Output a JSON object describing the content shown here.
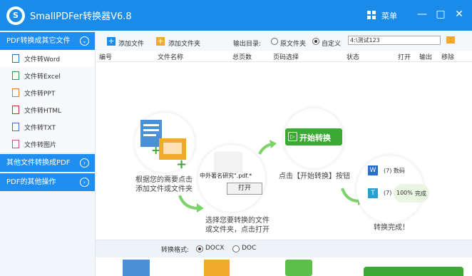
{
  "app": {
    "title": "SmallPDFer转换器V6.8",
    "menu_label": "菜单",
    "logo_letter": "S"
  },
  "window_controls": {
    "minimize": "—",
    "maximize": "□",
    "close": "✕"
  },
  "sidebar": {
    "cat1": "PDF转换成其它文件",
    "items": [
      "文件转Word",
      "文件转Excel",
      "文件转PPT",
      "文件转HTML",
      "文件转TXT",
      "文件转图片"
    ],
    "cat2": "其他文件转换成PDF",
    "cat3": "PDF的其他操作"
  },
  "toolbar": {
    "add_file": "添加文件",
    "add_folder": "添加文件夹",
    "output_label": "输出目录:",
    "opt_original": "原文件夹",
    "opt_custom": "自定义",
    "path_value": "4:\\测试123"
  },
  "table_headers": [
    "编号",
    "文件名称",
    "总页数",
    "页码选择",
    "状态",
    "打开",
    "输出",
    "移除"
  ],
  "illustration": {
    "step1_caption_line1": "根据您的需要点击",
    "step1_caption_line2": "添加文件或文件夹",
    "step2_caption_line1": "选择您要转换的文件",
    "step2_caption_line2": "或文件夹，点击打开",
    "step2_filename": "中外著名研究\".pdf.*",
    "step2_open": "打开",
    "step3_button": "开始转换",
    "step3_caption": "点击【开始转换】按钮",
    "step4_row1": "(7)  数码",
    "step4_row2": "(7)",
    "step4_progress": "100%",
    "step4_done_word": "完成",
    "step4_caption": "转换完成！"
  },
  "format_bar": {
    "label": "转换格式:",
    "opt1": "DOCX",
    "opt2": "DOC"
  },
  "colors": {
    "primary": "#1a8be8",
    "green": "#3aaa35",
    "orange": "#f0a92a"
  }
}
